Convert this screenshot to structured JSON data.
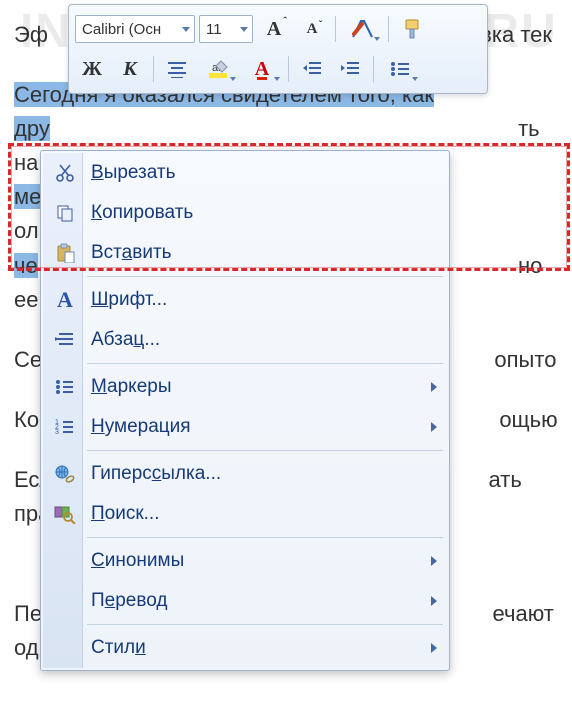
{
  "watermark": "INFOCONNECTOR.RU",
  "document": {
    "line1_pre": "Эф",
    "line1_post": "вка тек",
    "line2_sel": "Сегодня я оказался свидетелем того, как",
    "line3_pre_sel_a": "дру",
    "line3_post_a": "ть на э",
    "line4_pre_sel_a": "ме",
    "line4_post_a": "ользо",
    "line5_pre_sel_a": "че",
    "line5_post_a": "но ее",
    "line6_a": "Сег",
    "line6_b": "опыто",
    "line7_a": "Ко",
    "line7_b": "ощью",
    "line8_a": "Есл",
    "line8_b": "ать пра",
    "line9_a": "Пер",
    "line9_b": "ечают",
    "line10": "одного документа в другой. Пункты «Вы"
  },
  "toolbar": {
    "font_name": "Calibri (Оcн",
    "font_size": "11"
  },
  "menu": {
    "cut": {
      "pre": "",
      "u": "В",
      "post": "ырезать"
    },
    "copy": {
      "pre": "",
      "u": "К",
      "post": "опировать"
    },
    "paste": {
      "pre": "Вст",
      "u": "а",
      "post": "вить"
    },
    "font": {
      "pre": "",
      "u": "Ш",
      "post": "рифт..."
    },
    "para": {
      "pre": "Абза",
      "u": "ц",
      "post": "..."
    },
    "bullets": {
      "pre": "",
      "u": "М",
      "post": "аркеры"
    },
    "numbers": {
      "pre": "",
      "u": "Н",
      "post": "умерация"
    },
    "hyperlink": {
      "pre": "Гиперс",
      "u": "с",
      "post": "ылка..."
    },
    "search": {
      "pre": "",
      "u": "П",
      "post": "оиск..."
    },
    "synonyms": {
      "pre": "",
      "u": "С",
      "post": "инонимы"
    },
    "translate": {
      "pre": "П",
      "u": "е",
      "post": "ревод"
    },
    "styles": {
      "pre": "Стил",
      "u": "и",
      "post": ""
    }
  }
}
